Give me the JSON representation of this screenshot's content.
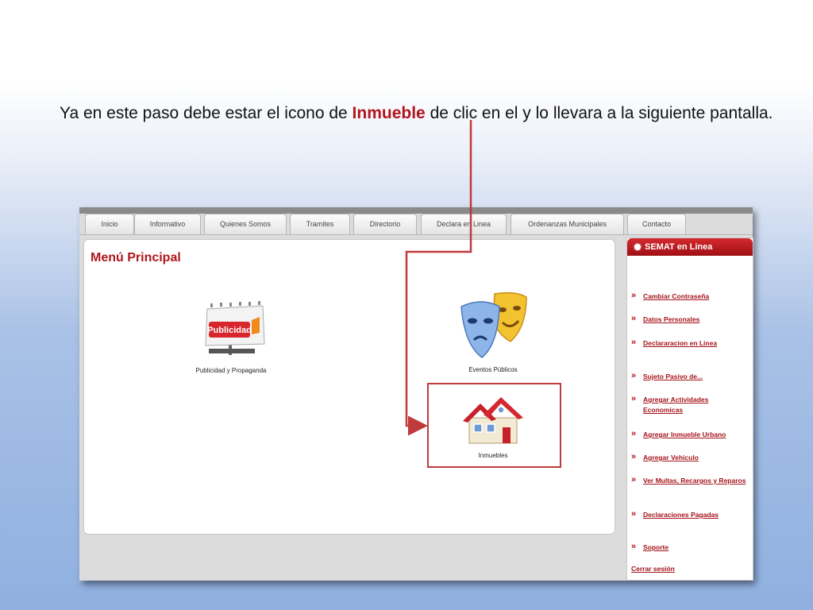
{
  "slide": {
    "text_before": "Ya en este paso debe estar el icono de ",
    "highlight": "Inmueble",
    "text_after": " de clic en el y lo llevara a la siguiente pantalla."
  },
  "nav": {
    "tabs": [
      "Inicio",
      "Informativo",
      "Quienes Somos",
      "Tramites",
      "Directorio",
      "Declara en Linea",
      "Ordenanzas Municipales",
      "Contacto"
    ]
  },
  "main": {
    "title": "Menú Principal",
    "items": [
      {
        "label": "Publicidad y Propaganda",
        "icon": "billboard-icon",
        "sign_text": "Publicidad"
      },
      {
        "label": "Eventos Públicos",
        "icon": "theater-masks-icon"
      },
      {
        "label": "Inmuebles",
        "icon": "house-icon"
      }
    ]
  },
  "sidebar": {
    "title": "SEMAT en Linea",
    "links": [
      "Cambiar Contraseña",
      "Datos Personales",
      "Declararacion en Linea",
      "Sujeto Pasivo de...",
      "Agregar Actividades Economicas",
      "Agregar Inmueble Urbano",
      "Agregar Vehiculo",
      "Ver Multas, Recargos y Reparos",
      "Declaraciones Pagadas",
      "Soporte"
    ],
    "logout": "Cerrar sesión"
  },
  "colors": {
    "accent": "#b0151d",
    "highlight_box": "#c0393d"
  }
}
